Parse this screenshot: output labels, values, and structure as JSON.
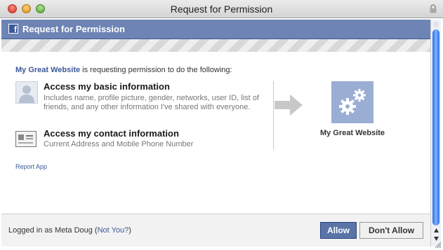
{
  "window": {
    "title": "Request for Permission"
  },
  "header": {
    "title": "Request for Permission"
  },
  "intro": {
    "site": "My Great Website",
    "text": " is requesting permission to do the following:"
  },
  "permissions": [
    {
      "title": "Access my basic information",
      "description": "Includes name, profile picture, gender, networks, user ID, list of friends, and any other information I've shared with everyone."
    },
    {
      "title": "Access my contact information",
      "description": "Current Address and Mobile Phone Number"
    }
  ],
  "report_link": "Report App",
  "app": {
    "name": "My Great Website"
  },
  "footer": {
    "logged_prefix": "Logged in as Meta Doug (",
    "not_you": "Not You?",
    "logged_suffix": ")"
  },
  "buttons": {
    "allow": "Allow",
    "deny": "Don't Allow"
  },
  "colors": {
    "facebook_blue": "#3b5998",
    "header_bg": "#6d84b4",
    "app_icon_bg": "#9aaed4",
    "allow_button": "#5b74a8"
  },
  "icons": [
    "close-icon",
    "minimize-icon",
    "zoom-icon",
    "lock-icon",
    "facebook-logo-icon",
    "user-silhouette-icon",
    "contact-card-icon",
    "arrow-right-icon",
    "gears-icon",
    "scroll-up-icon",
    "scroll-down-icon",
    "resize-grip-icon"
  ]
}
